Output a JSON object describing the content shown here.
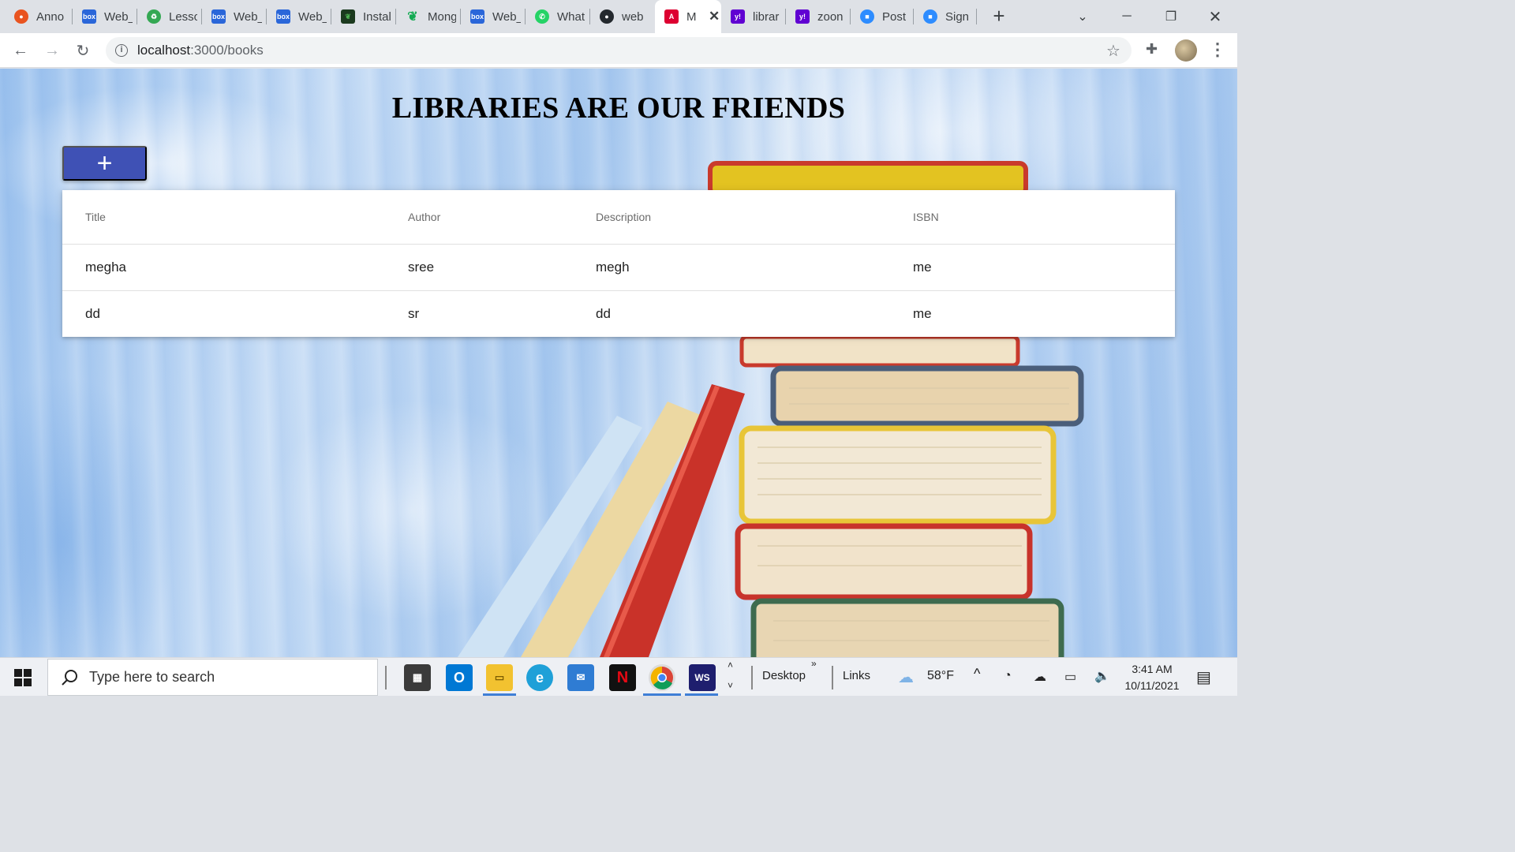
{
  "browser": {
    "tabs": [
      {
        "title": "Anno",
        "favicon": "ubuntu-icon",
        "color": "#e95420"
      },
      {
        "title": "Web_",
        "favicon": "box-icon",
        "color": "#2a66d9"
      },
      {
        "title": "Lesso",
        "favicon": "recycle-icon",
        "color": "#34a853"
      },
      {
        "title": "Web_",
        "favicon": "box-icon",
        "color": "#2a66d9"
      },
      {
        "title": "Web_",
        "favicon": "box-icon",
        "color": "#2a66d9"
      },
      {
        "title": "Instal",
        "favicon": "mongodb-leaf-icon",
        "color": "#1b3a1e"
      },
      {
        "title": "Mong",
        "favicon": "mongodb-leaf-icon",
        "color": "#13aa52"
      },
      {
        "title": "Web_",
        "favicon": "box-icon",
        "color": "#2a66d9"
      },
      {
        "title": "What",
        "favicon": "whatsapp-icon",
        "color": "#25d366"
      },
      {
        "title": "web",
        "favicon": "github-icon",
        "color": "#24292e"
      },
      {
        "title": "M",
        "favicon": "angular-icon",
        "color": "#dd0031"
      },
      {
        "title": "librar",
        "favicon": "yahoo-icon",
        "color": "#6001d2"
      },
      {
        "title": "zoon",
        "favicon": "yahoo-icon",
        "color": "#6001d2"
      },
      {
        "title": "Post",
        "favicon": "zoom-icon",
        "color": "#2d8cff"
      },
      {
        "title": "Sign",
        "favicon": "zoom-icon",
        "color": "#2d8cff"
      }
    ],
    "active_tab_index": 10,
    "url_host": "localhost",
    "url_path": ":3000/books"
  },
  "page": {
    "title": "LIBRARIES ARE OUR FRIENDS",
    "add_button_label": "+",
    "accent": "#3f51b5",
    "table": {
      "columns": [
        "Title",
        "Author",
        "Description",
        "ISBN"
      ],
      "rows": [
        [
          "megha",
          "sree",
          "megh",
          "me"
        ],
        [
          "dd",
          "sr",
          "dd",
          "me"
        ]
      ]
    }
  },
  "taskbar": {
    "search_placeholder": "Type here to search",
    "desktop_label": "Desktop",
    "links_label": "Links",
    "weather": "58°F",
    "time": "3:41 AM",
    "date": "10/11/2021"
  }
}
